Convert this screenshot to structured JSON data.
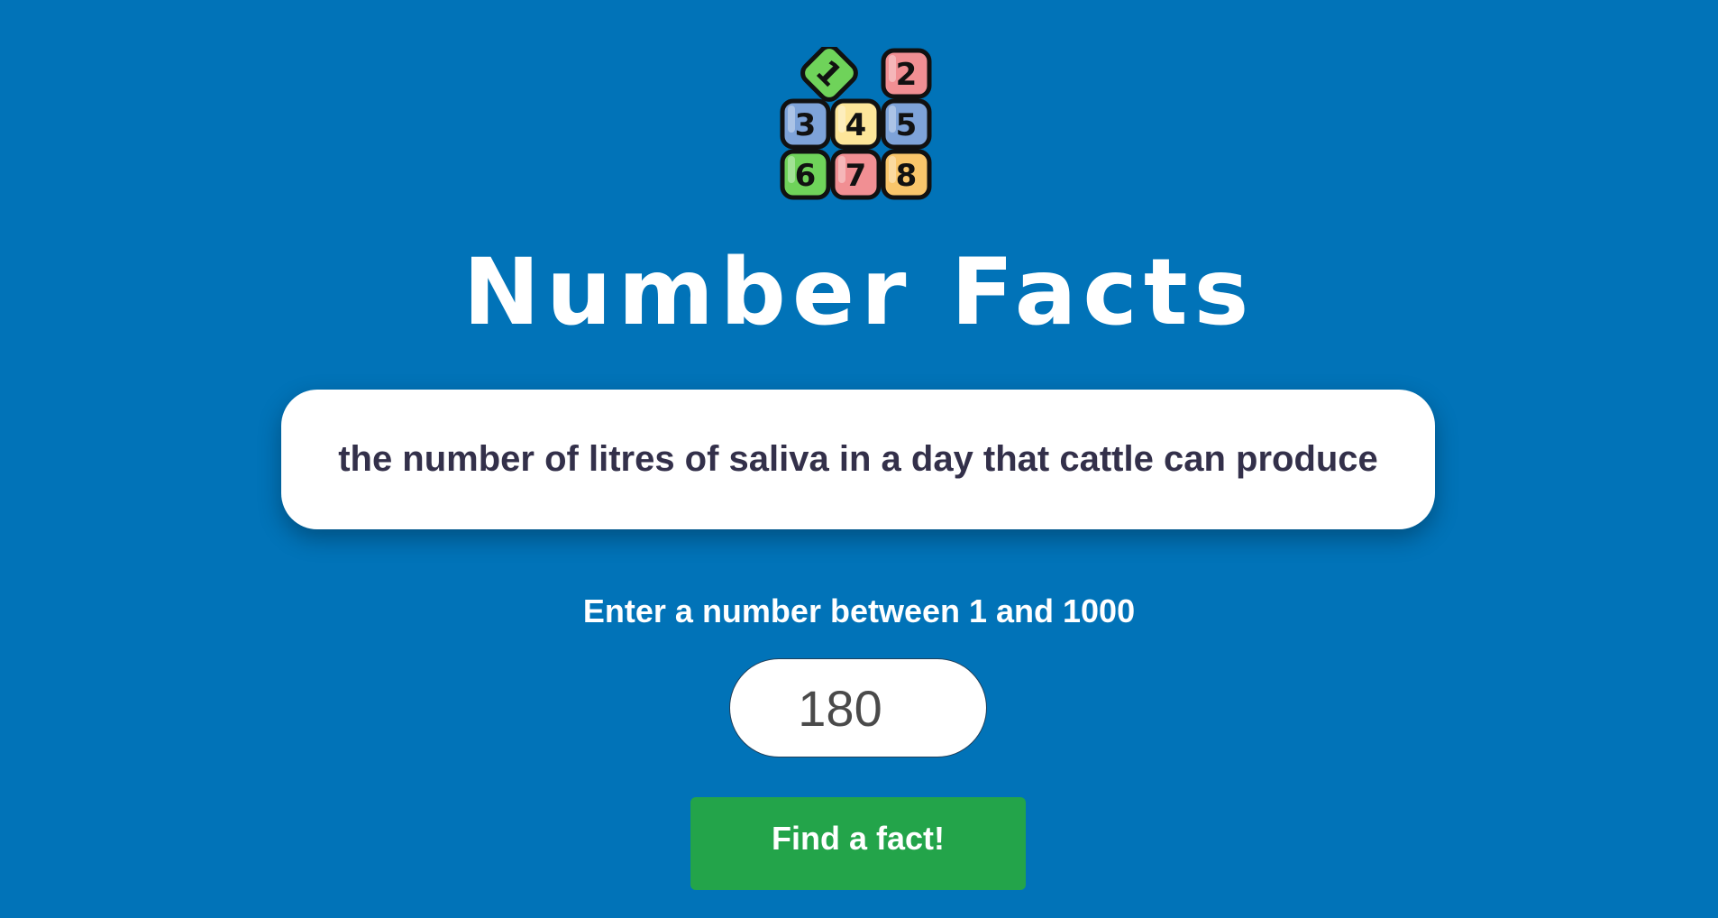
{
  "logo": {
    "icon": "number-blocks-icon",
    "tiles": [
      "1",
      "2",
      "3",
      "4",
      "5",
      "6",
      "7",
      "8"
    ],
    "colors": {
      "green": "#6fd35a",
      "red": "#f18f93",
      "blue": "#7ea3d9",
      "yellow": "#fde69a",
      "orange": "#f9c66b"
    }
  },
  "header": {
    "title": "Number Facts"
  },
  "fact": {
    "text": "the number of litres of saliva in a day that cattle can produce"
  },
  "form": {
    "prompt": "Enter a number between 1 and 1000",
    "number_value": "180",
    "button_label": "Find a fact!"
  },
  "colors": {
    "background": "#0173b8",
    "button": "#23a44a",
    "card": "#ffffff"
  }
}
